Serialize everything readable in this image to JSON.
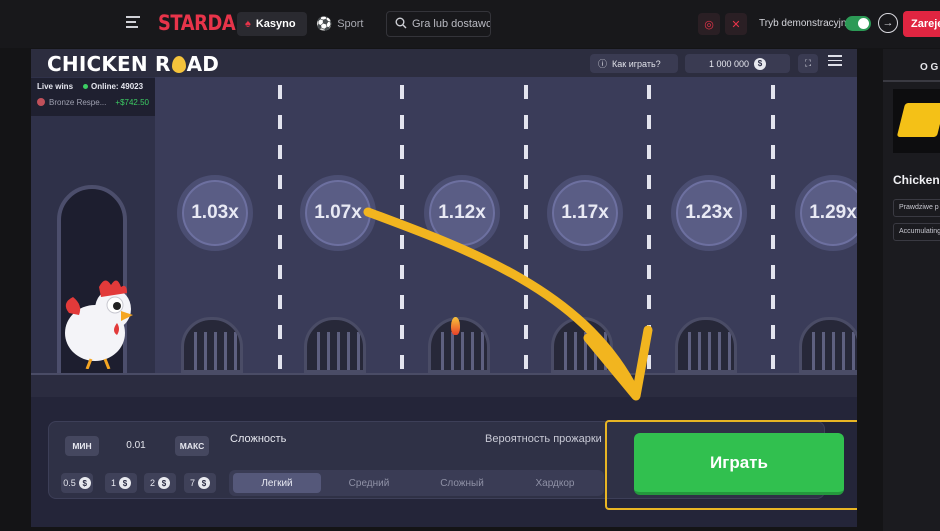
{
  "header": {
    "brand": "STARDA",
    "nav": {
      "kasyno": "Kasyno",
      "sport": "Sport"
    },
    "search_placeholder": "Gra lub dostawca",
    "demo_label": "Tryb demonstracyjny",
    "register_label": "Zarejes"
  },
  "game": {
    "title_left": "CHICKEN R",
    "title_right": "AD",
    "how_to_play": "Как играть?",
    "balance": "1 000 000",
    "currency_symbol": "$",
    "live_wins": {
      "label": "Live wins",
      "online_label": "Online: 49023",
      "player": "Bronze Respe...",
      "amount": "+$742.50"
    },
    "multipliers": [
      "1.03x",
      "1.07x",
      "1.12x",
      "1.17x",
      "1.23x",
      "1.29x"
    ],
    "controls": {
      "min_label": "МИН",
      "max_label": "МАКС",
      "bet_value": "0.01",
      "chips": [
        "0.5",
        "1",
        "2",
        "7"
      ],
      "complexity_label": "Сложность",
      "probability_label": "Вероятность прожарки",
      "difficulties": [
        "Легкий",
        "Средний",
        "Сложный",
        "Хардкор"
      ],
      "active_difficulty": "Легкий",
      "play_label": "Играть"
    }
  },
  "right_rail": {
    "tab": "O G",
    "title": "Chicken",
    "chips": [
      "Prawdziwe p",
      "Accumulating"
    ]
  },
  "colors": {
    "brand_red": "#e8344a",
    "play_green": "#31c04f",
    "highlight_yellow": "#e8b524",
    "scene_bg": "#3a3c59"
  }
}
